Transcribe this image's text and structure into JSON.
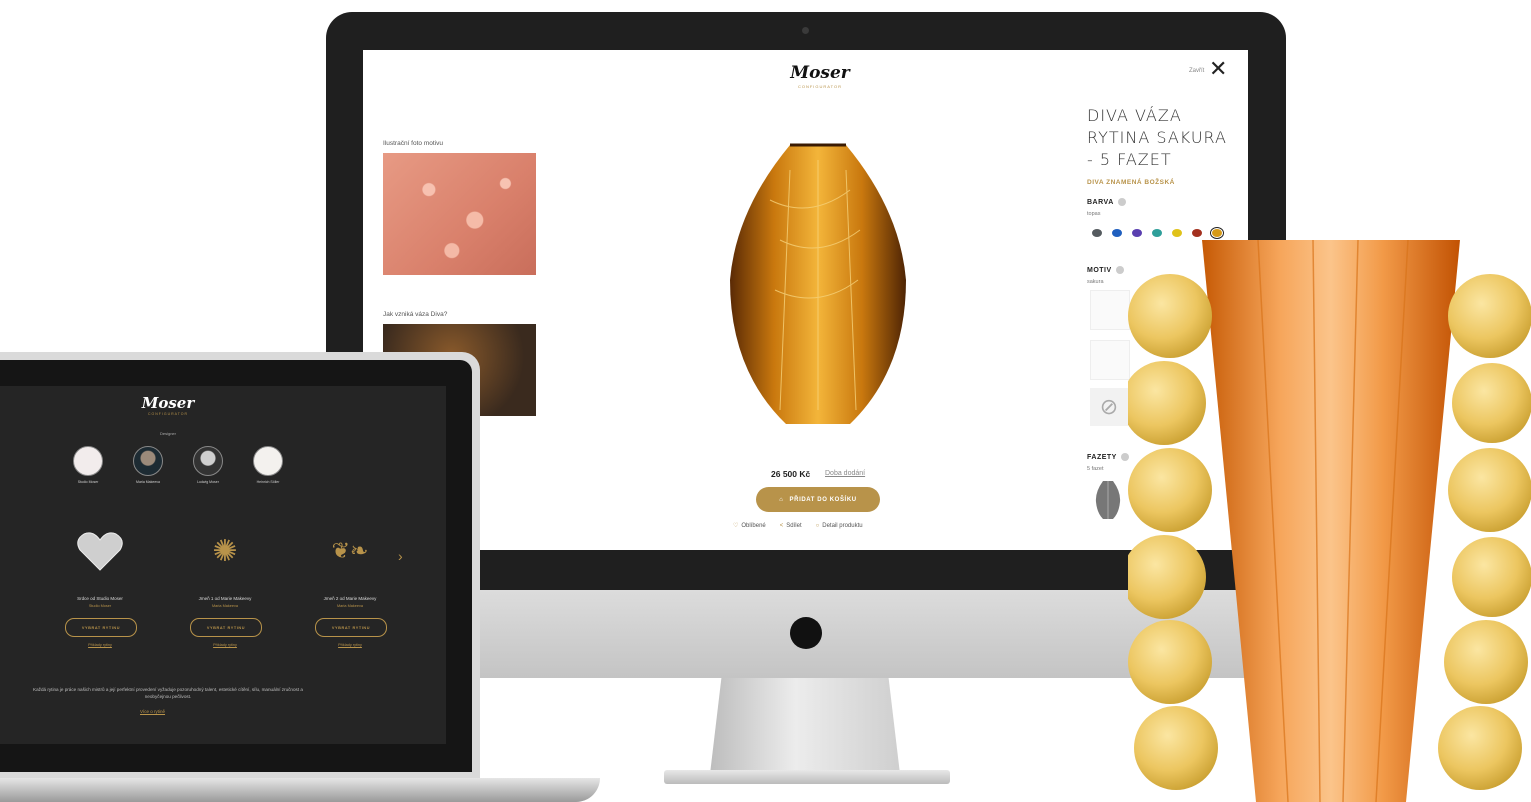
{
  "imac_screen": {
    "logo": "Moser",
    "logo_sub": "CONFIGURATOR",
    "close_label": "Zavřít",
    "illustration_label": "Ilustrační foto motivu",
    "vase_video_label": "Jak vzniká váza Diva?",
    "price": "26 500 Kč",
    "delivery_link": "Doba dodání",
    "add_to_cart": "PŘIDAT DO KOŠÍKU",
    "actions": [
      "Oblíbené",
      "Sdílet",
      "Detail produktu"
    ],
    "product_title": "DIVA VÁZA RYTINA SAKURA - 5 FAZET",
    "product_subtitle": "DIVA ZNAMENÁ BOŽSKÁ",
    "color_section": {
      "heading": "BARVA",
      "value": "topas"
    },
    "swatch_colors": [
      "#555b5f",
      "#1f5fbf",
      "#5a3fb0",
      "#2f9f9a",
      "#e0c21a",
      "#a3301e",
      "#d69a16"
    ],
    "motif_section": {
      "heading": "MOTIV",
      "value": "sakura"
    },
    "facets_section": {
      "heading": "FAZETY",
      "value": "5 fazet"
    }
  },
  "laptop_screen": {
    "logo": "Moser",
    "logo_sub": "CONFIGURATOR",
    "designer_label": "Designer",
    "designers": [
      "Studio Moser",
      "Maria Makeeva",
      "Ludwig Moser",
      "Heinrich Söller"
    ],
    "items": [
      {
        "title": "Srdce od Studio Moser",
        "sub": "Studio Moser",
        "button": "VYBRAT RYTINU",
        "link": "Příklady rytiny"
      },
      {
        "title": "Jmeň 1 od Marie Makeevy",
        "sub": "Maria Makeeva",
        "button": "VYBRAT RYTINU",
        "link": "Příklady rytiny"
      },
      {
        "title": "Jmeň 2 od Marie Makeevy",
        "sub": "Maria Makeeva",
        "button": "VYBRAT RYTINU",
        "link": "Příklady rytiny"
      }
    ],
    "footer_text": "Každá rytina je práce našich mistrů a její perfektní provedení vyžaduje pozoruhodný talent, estetické cítění, sílu, manuální zručnost a neobyčejnou pečlivost.",
    "footer_link": "Více o rytině",
    "accent": "#b8934a"
  }
}
